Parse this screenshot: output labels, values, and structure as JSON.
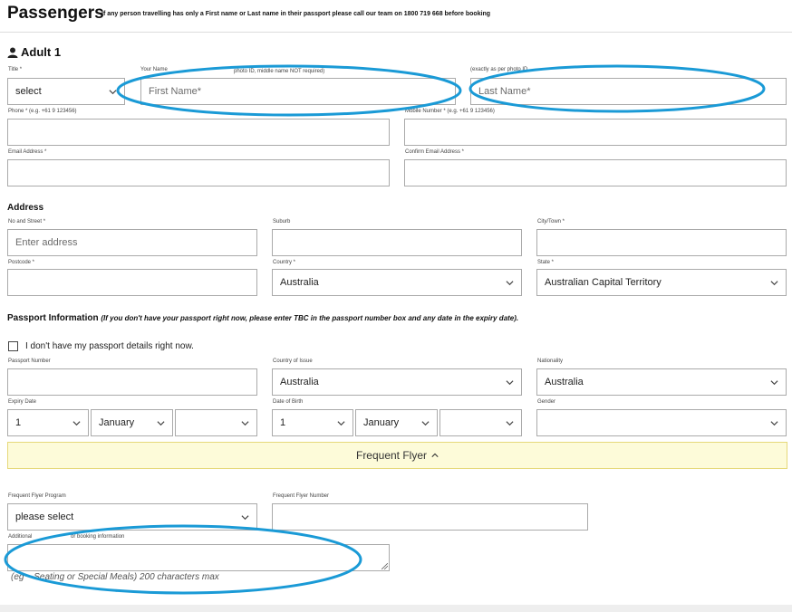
{
  "header": {
    "title": "Passengers",
    "notice": "If any person travelling has only a First name or Last name in their passport please call our team on 1800 719 668 before booking"
  },
  "adult": {
    "heading": "Adult 1",
    "title_label": "Title *",
    "title_value": "select",
    "name_label_left": "Your Name",
    "name_label_mid": "photo ID, middle name NOT required)",
    "lastname_label": "(exactly as per photo ID",
    "first_name_placeholder": "First Name*",
    "last_name_placeholder": "Last Name*",
    "phone_label": "Phone * (e.g. +61 9 123456)",
    "mobile_label": "Mobile Number * (e.g. +61 9 123456)",
    "email_label": "Email Address *",
    "confirm_email_label": "Confirm Email Address *"
  },
  "address": {
    "heading": "Address",
    "street_label": "No and Street *",
    "street_placeholder": "Enter address",
    "suburb_label": "Suburb",
    "city_label": "City/Town *",
    "postcode_label": "Postcode *",
    "country_label": "Country *",
    "country_value": "Australia",
    "state_label": "State *",
    "state_value": "Australian Capital Territory"
  },
  "passport": {
    "heading": "Passport Information",
    "note": "(If you don't have your passport right now, please enter TBC in the passport number box and any date in the expiry date).",
    "checkbox_label": "I don't have my passport details right now.",
    "number_label": "Passport Number",
    "issue_label": "Country of Issue",
    "issue_value": "Australia",
    "nationality_label": "Nationality",
    "nationality_value": "Australia",
    "expiry_label": "Expiry Date",
    "expiry_day": "1",
    "expiry_month": "January",
    "expiry_year": "",
    "dob_label": "Date of Birth",
    "dob_day": "1",
    "dob_month": "January",
    "dob_year": "",
    "gender_label": "Gender",
    "gender_value": ""
  },
  "frequent_flyer": {
    "toggle_label": "Frequent Flyer",
    "program_label": "Frequent Flyer Program",
    "program_value": "please select",
    "number_label": "Frequent Flyer Number",
    "additional_label_left": "Additional",
    "additional_label_right": "or booking information",
    "help_left": "(eg",
    "help_right": "Seating or Special Meals) 200 characters max"
  },
  "annotations": {
    "ellipse_color": "#1a9ad6"
  }
}
